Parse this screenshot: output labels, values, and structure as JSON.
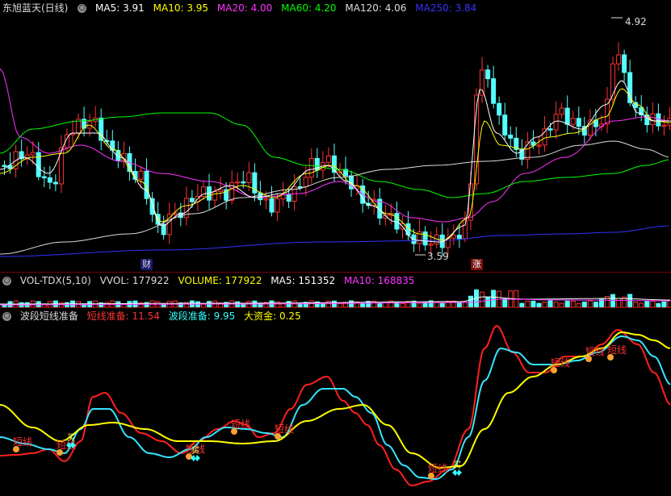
{
  "price": {
    "title": "东旭蓝天(日线)",
    "indicators": [
      {
        "label": "MA5: 3.91",
        "color": "#ffffff"
      },
      {
        "label": "MA10: 3.95",
        "color": "#ffff00"
      },
      {
        "label": "MA20: 4.00",
        "color": "#ff33ff"
      },
      {
        "label": "MA60: 4.20",
        "color": "#00ff00"
      },
      {
        "label": "MA120: 4.06",
        "color": "#dcdcdc"
      },
      {
        "label": "MA250: 3.84",
        "color": "#3333ff"
      }
    ],
    "high_label": "4.92",
    "low_label": "3.59",
    "event_cai": "财",
    "event_zhang": "涨",
    "settings_icon": "settings-circle-icon"
  },
  "volume": {
    "title": "VOL-TDX(5,10)",
    "indicators": [
      {
        "label": "VVOL: 177922",
        "color": "#dcdcdc"
      },
      {
        "label": "VOLUME: 177922",
        "color": "#ffff00"
      },
      {
        "label": "MA5: 151352",
        "color": "#ffffff"
      },
      {
        "label": "MA10: 168835",
        "color": "#ff33ff"
      }
    ]
  },
  "band": {
    "title": "波段短线准备",
    "indicators": [
      {
        "label": "短线准备: 11.54",
        "color": "#ff3333"
      },
      {
        "label": "波段准备: 9.95",
        "color": "#33ffff"
      },
      {
        "label": "大资金: 0.25",
        "color": "#ffff00"
      }
    ],
    "signal_text": "短线",
    "buy_text": "买"
  },
  "colors": {
    "up": "#ff3232",
    "down": "#54ffff",
    "ma5": "#ffffff",
    "ma10": "#ffff00",
    "ma20": "#ff33ff",
    "ma60": "#00ff00",
    "ma120": "#dcdcdc",
    "ma250": "#3333ff",
    "short": "#ff2020",
    "band": "#33e6ff",
    "big": "#ffff00"
  }
}
